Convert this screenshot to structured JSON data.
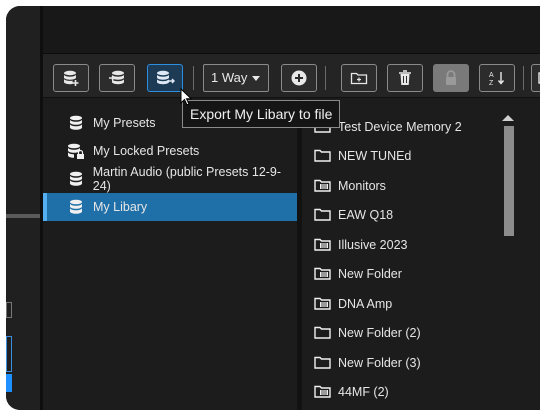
{
  "toolbar": {
    "buttons": [
      {
        "name": "new-preset-button",
        "icon": "database-add-icon"
      },
      {
        "name": "import-preset-button",
        "icon": "database-import-icon"
      },
      {
        "name": "export-library-button",
        "icon": "database-export-icon",
        "active": true
      }
    ],
    "sync_direction": {
      "selected": "1 Way"
    },
    "add_button_icon": "plus-circle-icon",
    "more_buttons": [
      {
        "name": "new-folder-button",
        "icon": "folder-add-icon"
      },
      {
        "name": "delete-button",
        "icon": "trash-icon"
      },
      {
        "name": "lock-button",
        "icon": "lock-icon",
        "disabled": true
      },
      {
        "name": "sort-button",
        "icon": "sort-az-icon"
      }
    ]
  },
  "tooltip": {
    "text": "Export My Libary to file"
  },
  "library_tree": {
    "items": [
      {
        "label": "My Presets",
        "icon": "database-icon",
        "selected": false
      },
      {
        "label": "My Locked Presets",
        "icon": "database-lock-icon",
        "selected": false
      },
      {
        "label": "Martin Audio (public Presets 12-9-24)",
        "icon": "database-icon",
        "selected": false
      },
      {
        "label": "My Libary",
        "icon": "database-icon",
        "selected": true
      }
    ]
  },
  "file_list": {
    "items": [
      {
        "label": "Test Device Memory 2",
        "icon": "folder-icon"
      },
      {
        "label": "NEW TUNEd",
        "icon": "folder-icon"
      },
      {
        "label": "Monitors",
        "icon": "amp-folder-icon"
      },
      {
        "label": "EAW Q18",
        "icon": "folder-icon"
      },
      {
        "label": "Illusive 2023",
        "icon": "amp-folder-icon"
      },
      {
        "label": "New Folder",
        "icon": "amp-folder-icon"
      },
      {
        "label": "DNA Amp",
        "icon": "amp-folder-icon"
      },
      {
        "label": "New Folder (2)",
        "icon": "folder-icon"
      },
      {
        "label": "New Folder (3)",
        "icon": "folder-icon"
      },
      {
        "label": "44MF (2)",
        "icon": "amp-folder-icon"
      }
    ]
  },
  "colors": {
    "accent": "#2d8ee0",
    "selection": "#1f6fa8",
    "background": "#1c1c1c"
  }
}
